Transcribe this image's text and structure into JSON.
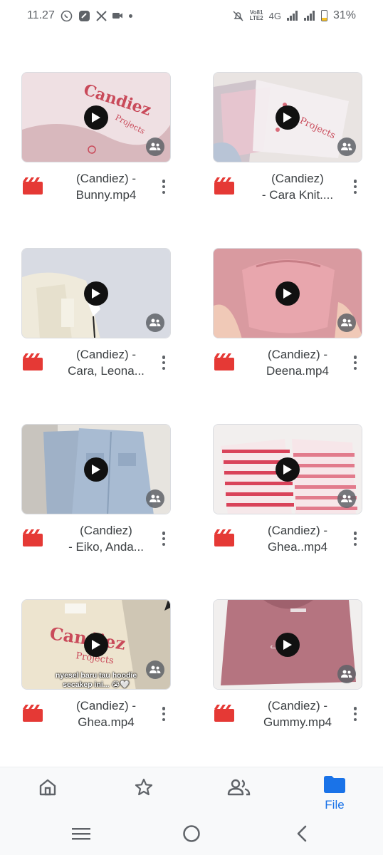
{
  "status_bar": {
    "time": "11.27",
    "net_label_top": "Vo81",
    "net_label_bottom": "LTE2",
    "net_type": "4G",
    "battery": "31%",
    "battery_level": 0.31
  },
  "files": [
    {
      "title_line1": "(Candiez) -",
      "title_line2": "Bunny.mp4",
      "thumb": "pink-bag-logo"
    },
    {
      "title_line1": "(Candiez)",
      "title_line2": "- Cara Knit....",
      "thumb": "pink-knit-pack"
    },
    {
      "title_line1": "(Candiez) -",
      "title_line2": "Cara, Leona...",
      "thumb": "cream-cardigan"
    },
    {
      "title_line1": "(Candiez) -",
      "title_line2": "Deena.mp4",
      "thumb": "pink-drawstring"
    },
    {
      "title_line1": "(Candiez)",
      "title_line2": "- Eiko, Anda...",
      "thumb": "denim-jacket"
    },
    {
      "title_line1": "(Candiez) -",
      "title_line2": "Ghea..mp4",
      "thumb": "striped-hoodie"
    },
    {
      "title_line1": "(Candiez) -",
      "title_line2": "Ghea.mp4",
      "thumb": "cream-hoodie-text",
      "overlay_text_1": "nyesel baru tau hoodie",
      "overlay_text_2": "secakep ini... 😭🤍"
    },
    {
      "title_line1": "(Candiez) -",
      "title_line2": "Gummy.mp4",
      "thumb": "mauve-sweater"
    }
  ],
  "bottom_nav": {
    "home_icon": "home-icon",
    "starred_icon": "star-icon",
    "shared_icon": "people-icon",
    "files_label": "File",
    "active": "files"
  },
  "colors": {
    "accent": "#1a73e8",
    "video_icon": "#e53935",
    "text": "#3c4043"
  }
}
